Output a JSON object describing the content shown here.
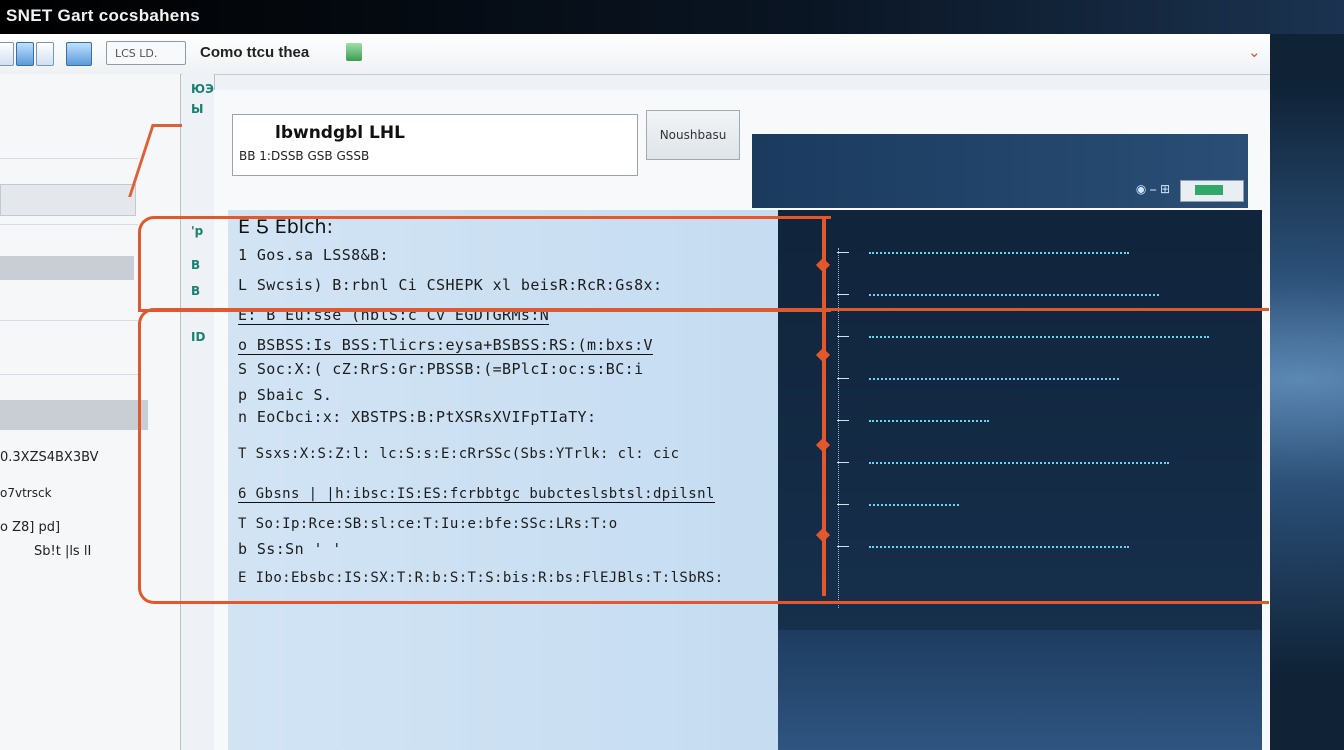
{
  "app": {
    "title": "SNET Gart cocsbahens"
  },
  "toolbar": {
    "field_label": "LCS LD.",
    "document_title": "Como ttcu thea",
    "chevron": "⌄"
  },
  "left_panel": {
    "rows": [
      "0.3XZS4BX3BV",
      "o7vtrsck",
      "o Z8]  pd]",
      "Sb!t |ls  lI"
    ]
  },
  "gutter": {
    "markers": [
      "ЮЭ",
      "Ы",
      "'p",
      "B",
      "B",
      "ID"
    ]
  },
  "header": {
    "title": "lbwndgbl LHL",
    "subtitle": "BB  1:DSSB  GSB  GSSB",
    "button_label": "Noushbasu"
  },
  "editor": {
    "pane_label": "E Ƽ  Eblch:",
    "lines": [
      "1  Gos.sa                        LSS8&B:",
      "L  Swcsis) B:rbnl Ci  CSHEPK xl  beisR:RcR:Gs8x:",
      "E: B  Eu:sse (hblS:c Cv  EGDTGRMs:N",
      "o  BSBSS:Is BSS:Tlicrs:eysa+BSBSS:RS:(m:bxs:V",
      "S  Soc:X:(  cZ:RrS:Gr:PBSSB:(=BPlcI:oc:s:BC:i",
      "p  Sbaic  S.",
      "n  EoCbci:x:  XBSTPS:B:PtXSRsXVIFpTIaTY:",
      "T  Ssxs:X:S:Z:l:  lc:S:s:E:cRrSSc(Sbs:YTrlk:  cl:  cic",
      "6  Gbsns |  |h:ibsc:IS:ES:fcrbbtgc  bubcteslsbtsl:dpilsnl",
      "T  So:Ip:Rce:SB:sl:ce:T:Iu:e:bfe:SSc:LRs:T:o",
      "b  Ss:Sn '  '",
      "E  Ibo:Ebsbc:IS:SX:T:R:b:S:T:S:bis:R:bs:FlEJBls:T:lSbRS:"
    ]
  },
  "console": {
    "line_count": 8
  },
  "colors": {
    "accent": "#e2582c",
    "dark_pane": "#162f4b",
    "light_pane": "#c9dff2",
    "console_text": "#6cd2ee"
  }
}
